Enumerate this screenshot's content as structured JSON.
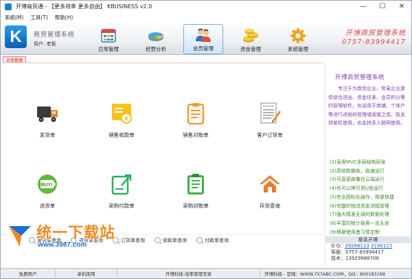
{
  "window": {
    "title": "开博商贸通 - 【更多效率 更多自由】 KBUSINESS v2.0",
    "minimize_glyph": "—",
    "maximize_glyph": "☐",
    "close_glyph": "✕"
  },
  "menu": [
    "系统(M)",
    "工具(T)",
    "帮助(H)"
  ],
  "header": {
    "logo_letter": "K",
    "system_name": "商贸管理系统",
    "user_line": "用户: 老板",
    "brand_name": "开博商贸管理系统",
    "brand_phone": "0757-83994417",
    "nav": [
      {
        "label": "日常管理",
        "icon": "calendar-grid-icon"
      },
      {
        "label": "经营分析",
        "icon": "pie-chart-icon"
      },
      {
        "label": "会员管理",
        "icon": "members-icon",
        "active": true
      },
      {
        "label": "资金管理",
        "icon": "coins-icon"
      },
      {
        "label": "系统管理",
        "icon": "gear-icon"
      }
    ]
  },
  "tab": {
    "label": "日常管理"
  },
  "tiles": [
    {
      "label": "发货单",
      "icon": "delivery-truck-icon"
    },
    {
      "label": "销售收款单",
      "icon": "yen-receipt-icon"
    },
    {
      "label": "销售对账单",
      "icon": "clipboard-icon"
    },
    {
      "label": "客户订货单",
      "icon": "order-document-icon"
    },
    {
      "label": "进货单",
      "icon": "buy-tag-icon"
    },
    {
      "label": "采购付款单",
      "icon": "edit-export-icon"
    },
    {
      "label": "采购对账单",
      "icon": "checklist-icon"
    },
    {
      "label": "存货查询",
      "icon": "home-stock-icon"
    }
  ],
  "search_links": [
    "发货单查询",
    "进货单查询",
    "订货单查询",
    "收款单查询",
    "付款单查询"
  ],
  "panel": {
    "title": "开博商贸管理系统",
    "description": "专注于为商贸企业、贸易企业提供综合进出、资金往来、会员积分等的管理软件，也适用于商铺、个体户等进行进销存管理或收银之用。既支持单机使用，也支持多人联网使用。",
    "features": [
      "(1)采用MVC多层结构研发",
      "(2)高效数据库，极速运行",
      "(3)可直接部署在云端运行",
      "(4)也可以拷贝到U盘运行",
      "(5)完全图标化操作，简便快捷",
      "(6)完整的物流资金流程管理",
      "(7)强大精准无误的数据处理",
      "(8)丰富的统计报表一览无余",
      "(9)根据使用者习惯定制"
    ],
    "contact": {
      "title": "联系开博",
      "qq_label": "Q Q：",
      "qq1": "29286113",
      "qq2": "3190115",
      "service": "客服：0757-83994417",
      "tech": "技术：13929988706"
    }
  },
  "watermark": {
    "brand": "统一下载站",
    "url": "www.3987.com"
  },
  "status": [
    "免费用户",
    "单机使用",
    "开博科技-效率管理专家",
    "开博科技 - 官网：WWW.757ABC.COM，QQ：800183188"
  ],
  "colors": {
    "accent": "#1b7fd0",
    "brand_red": "#dd4444",
    "panel_purple": "#7a3bb0",
    "feature_green": "#3a8a2a"
  }
}
